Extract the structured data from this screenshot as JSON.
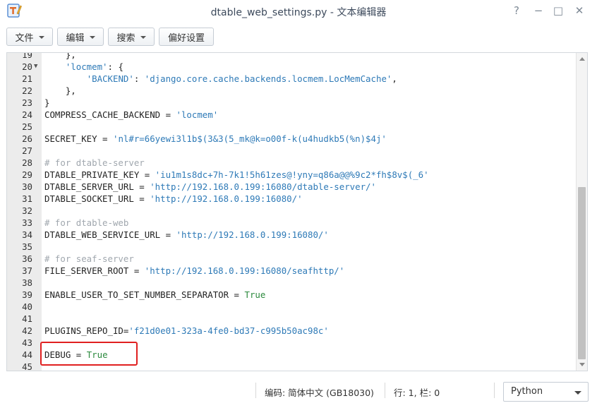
{
  "window": {
    "title": "dtable_web_settings.py - 文本编辑器",
    "help_icon": "?",
    "minimize_icon": "−",
    "maximize_icon": "□",
    "close_icon": "✕"
  },
  "toolbar": {
    "file_label": "文件",
    "edit_label": "编辑",
    "search_label": "搜索",
    "prefs_label": "偏好设置"
  },
  "editor": {
    "highlight_color": "#e02020",
    "lines": [
      {
        "n": "19",
        "fold": "",
        "segs": [
          {
            "t": "    },",
            "c": ""
          }
        ]
      },
      {
        "n": "20",
        "fold": "▼",
        "segs": [
          {
            "t": "    ",
            "c": ""
          },
          {
            "t": "'locmem'",
            "c": "str"
          },
          {
            "t": ": {",
            "c": ""
          }
        ]
      },
      {
        "n": "21",
        "fold": "",
        "segs": [
          {
            "t": "        ",
            "c": ""
          },
          {
            "t": "'BACKEND'",
            "c": "str"
          },
          {
            "t": ": ",
            "c": ""
          },
          {
            "t": "'django.core.cache.backends.locmem.LocMemCache'",
            "c": "str"
          },
          {
            "t": ",",
            "c": ""
          }
        ]
      },
      {
        "n": "22",
        "fold": "",
        "segs": [
          {
            "t": "    },",
            "c": ""
          }
        ]
      },
      {
        "n": "23",
        "fold": "",
        "segs": [
          {
            "t": "}",
            "c": ""
          }
        ]
      },
      {
        "n": "24",
        "fold": "",
        "segs": [
          {
            "t": "COMPRESS_CACHE_BACKEND = ",
            "c": ""
          },
          {
            "t": "'locmem'",
            "c": "str"
          }
        ]
      },
      {
        "n": "25",
        "fold": "",
        "segs": []
      },
      {
        "n": "26",
        "fold": "",
        "segs": [
          {
            "t": "SECRET_KEY = ",
            "c": ""
          },
          {
            "t": "'nl#r=66yewi3l1b$(3&3(5_mk@k=o00f-k(u4hudkb5(%n)$4j'",
            "c": "str"
          }
        ]
      },
      {
        "n": "27",
        "fold": "",
        "segs": []
      },
      {
        "n": "28",
        "fold": "",
        "segs": [
          {
            "t": "# for dtable-server",
            "c": "cm"
          }
        ]
      },
      {
        "n": "29",
        "fold": "",
        "segs": [
          {
            "t": "DTABLE_PRIVATE_KEY = ",
            "c": ""
          },
          {
            "t": "'iu1m1s8dc+7h-7k1!5h61zes@!yny=q86a@@%9c2*fh$8v$(_6'",
            "c": "str"
          }
        ]
      },
      {
        "n": "30",
        "fold": "",
        "segs": [
          {
            "t": "DTABLE_SERVER_URL = ",
            "c": ""
          },
          {
            "t": "'http://192.168.0.199:16080/dtable-server/'",
            "c": "str"
          }
        ]
      },
      {
        "n": "31",
        "fold": "",
        "segs": [
          {
            "t": "DTABLE_SOCKET_URL = ",
            "c": ""
          },
          {
            "t": "'http://192.168.0.199:16080/'",
            "c": "str"
          }
        ]
      },
      {
        "n": "32",
        "fold": "",
        "segs": []
      },
      {
        "n": "33",
        "fold": "",
        "segs": [
          {
            "t": "# for dtable-web",
            "c": "cm"
          }
        ]
      },
      {
        "n": "34",
        "fold": "",
        "segs": [
          {
            "t": "DTABLE_WEB_SERVICE_URL = ",
            "c": ""
          },
          {
            "t": "'http://192.168.0.199:16080/'",
            "c": "str"
          }
        ]
      },
      {
        "n": "35",
        "fold": "",
        "segs": []
      },
      {
        "n": "36",
        "fold": "",
        "segs": [
          {
            "t": "# for seaf-server",
            "c": "cm"
          }
        ]
      },
      {
        "n": "37",
        "fold": "",
        "segs": [
          {
            "t": "FILE_SERVER_ROOT = ",
            "c": ""
          },
          {
            "t": "'http://192.168.0.199:16080/seafhttp/'",
            "c": "str"
          }
        ]
      },
      {
        "n": "38",
        "fold": "",
        "segs": []
      },
      {
        "n": "39",
        "fold": "",
        "segs": [
          {
            "t": "ENABLE_USER_TO_SET_NUMBER_SEPARATOR = ",
            "c": ""
          },
          {
            "t": "True",
            "c": "kw"
          }
        ]
      },
      {
        "n": "40",
        "fold": "",
        "segs": []
      },
      {
        "n": "41",
        "fold": "",
        "segs": []
      },
      {
        "n": "42",
        "fold": "",
        "segs": [
          {
            "t": "PLUGINS_REPO_ID=",
            "c": ""
          },
          {
            "t": "'f21d0e01-323a-4fe0-bd37-c995b50ac98c'",
            "c": "str"
          }
        ]
      },
      {
        "n": "43",
        "fold": "",
        "segs": []
      },
      {
        "n": "44",
        "fold": "",
        "segs": [
          {
            "t": "DEBUG = ",
            "c": ""
          },
          {
            "t": "True",
            "c": "kw"
          }
        ]
      },
      {
        "n": "45",
        "fold": "",
        "segs": []
      }
    ]
  },
  "status": {
    "encoding": "编码: 简体中文 (GB18030)",
    "cursor": "行: 1, 栏: 0",
    "language": "Python"
  }
}
